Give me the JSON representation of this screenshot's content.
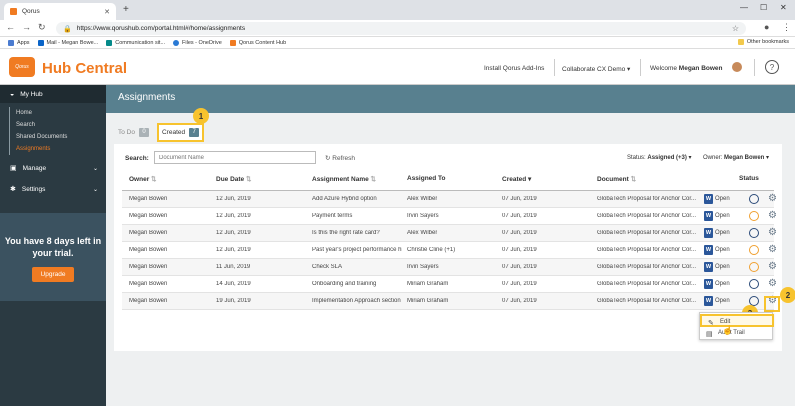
{
  "browser": {
    "tab_title": "Qorus",
    "url": "https://www.qorushub.com/portal.html#/home/assignments",
    "bookmarks": [
      "Apps",
      "Mail - Megan Bowe...",
      "Communication sit...",
      "Files - OneDrive",
      "Qorus Content Hub"
    ],
    "other_bookmarks": "Other bookmarks"
  },
  "header": {
    "logo_text": "Qorus",
    "title": "Hub Central",
    "install_addins": "Install Qorus Add-Ins",
    "workspace": "Collaborate CX Demo",
    "welcome": "Welcome",
    "user_name": "Megan Bowen",
    "help": "?"
  },
  "sidebar": {
    "my_hub": "My Hub",
    "sub_items": [
      "Home",
      "Search",
      "Shared Documents",
      "Assignments"
    ],
    "manage": "Manage",
    "settings": "Settings",
    "trial_text": "You have 8 days left in your trial.",
    "upgrade": "Upgrade"
  },
  "page": {
    "title": "Assignments",
    "tab_todo": "To Do",
    "tab_todo_count": "0",
    "tab_created": "Created",
    "tab_created_count": "7",
    "search_label": "Search:",
    "search_placeholder": "Document Name",
    "refresh": "Refresh",
    "status_filter_label": "Status:",
    "status_filter_value": "Assigned (+3)",
    "owner_filter_label": "Owner:",
    "owner_filter_value": "Megan Bowen"
  },
  "table": {
    "headers": [
      "Owner",
      "Due Date",
      "Assignment Name",
      "Assigned To",
      "Created",
      "Document",
      "Status"
    ],
    "open_label": "Open",
    "rows": [
      {
        "owner": "Megan Bowen",
        "due": "12 Jun, 2019",
        "name": "Add Azure Hybrid option",
        "assigned": "Alex Wilber",
        "created": "07 Jun, 2019",
        "document": "GlobaTech Proposal for Anchor Cor...",
        "status": "blue"
      },
      {
        "owner": "Megan Bowen",
        "due": "12 Jun, 2019",
        "name": "Payment terms",
        "assigned": "Irvin Sayers",
        "created": "07 Jun, 2019",
        "document": "GlobaTech Proposal for Anchor Cor...",
        "status": "orange"
      },
      {
        "owner": "Megan Bowen",
        "due": "12 Jun, 2019",
        "name": "Is this the right rate card?",
        "assigned": "Alex Wilber",
        "created": "07 Jun, 2019",
        "document": "GlobaTech Proposal for Anchor Cor...",
        "status": "blue"
      },
      {
        "owner": "Megan Bowen",
        "due": "12 Jun, 2019",
        "name": "Past year's project performance hig...",
        "assigned": "Christie Cline (+1)",
        "created": "07 Jun, 2019",
        "document": "GlobaTech Proposal for Anchor Cor...",
        "status": "orange"
      },
      {
        "owner": "Megan Bowen",
        "due": "11 Jun, 2019",
        "name": "Check SLA",
        "assigned": "Irvin Sayers",
        "created": "07 Jun, 2019",
        "document": "GlobaTech Proposal for Anchor Cor...",
        "status": "orange"
      },
      {
        "owner": "Megan Bowen",
        "due": "14 Jun, 2019",
        "name": "Onboarding and training",
        "assigned": "Miriam Graham",
        "created": "07 Jun, 2019",
        "document": "GlobaTech Proposal for Anchor Cor...",
        "status": "blue"
      },
      {
        "owner": "Megan Bowen",
        "due": "19 Jun, 2019",
        "name": "Implementation Approach section",
        "assigned": "Miriam Graham",
        "created": "07 Jun, 2019",
        "document": "GlobaTech Proposal for Anchor Cor...",
        "status": "blue"
      }
    ]
  },
  "context_menu": {
    "edit": "Edit",
    "audit_trail": "Audit Trail"
  },
  "callouts": [
    "1",
    "2",
    "3"
  ],
  "colors": {
    "accent": "#f07b22",
    "banner": "#58808f",
    "sidebar": "#2b3a42",
    "highlight": "#f7c32e"
  }
}
